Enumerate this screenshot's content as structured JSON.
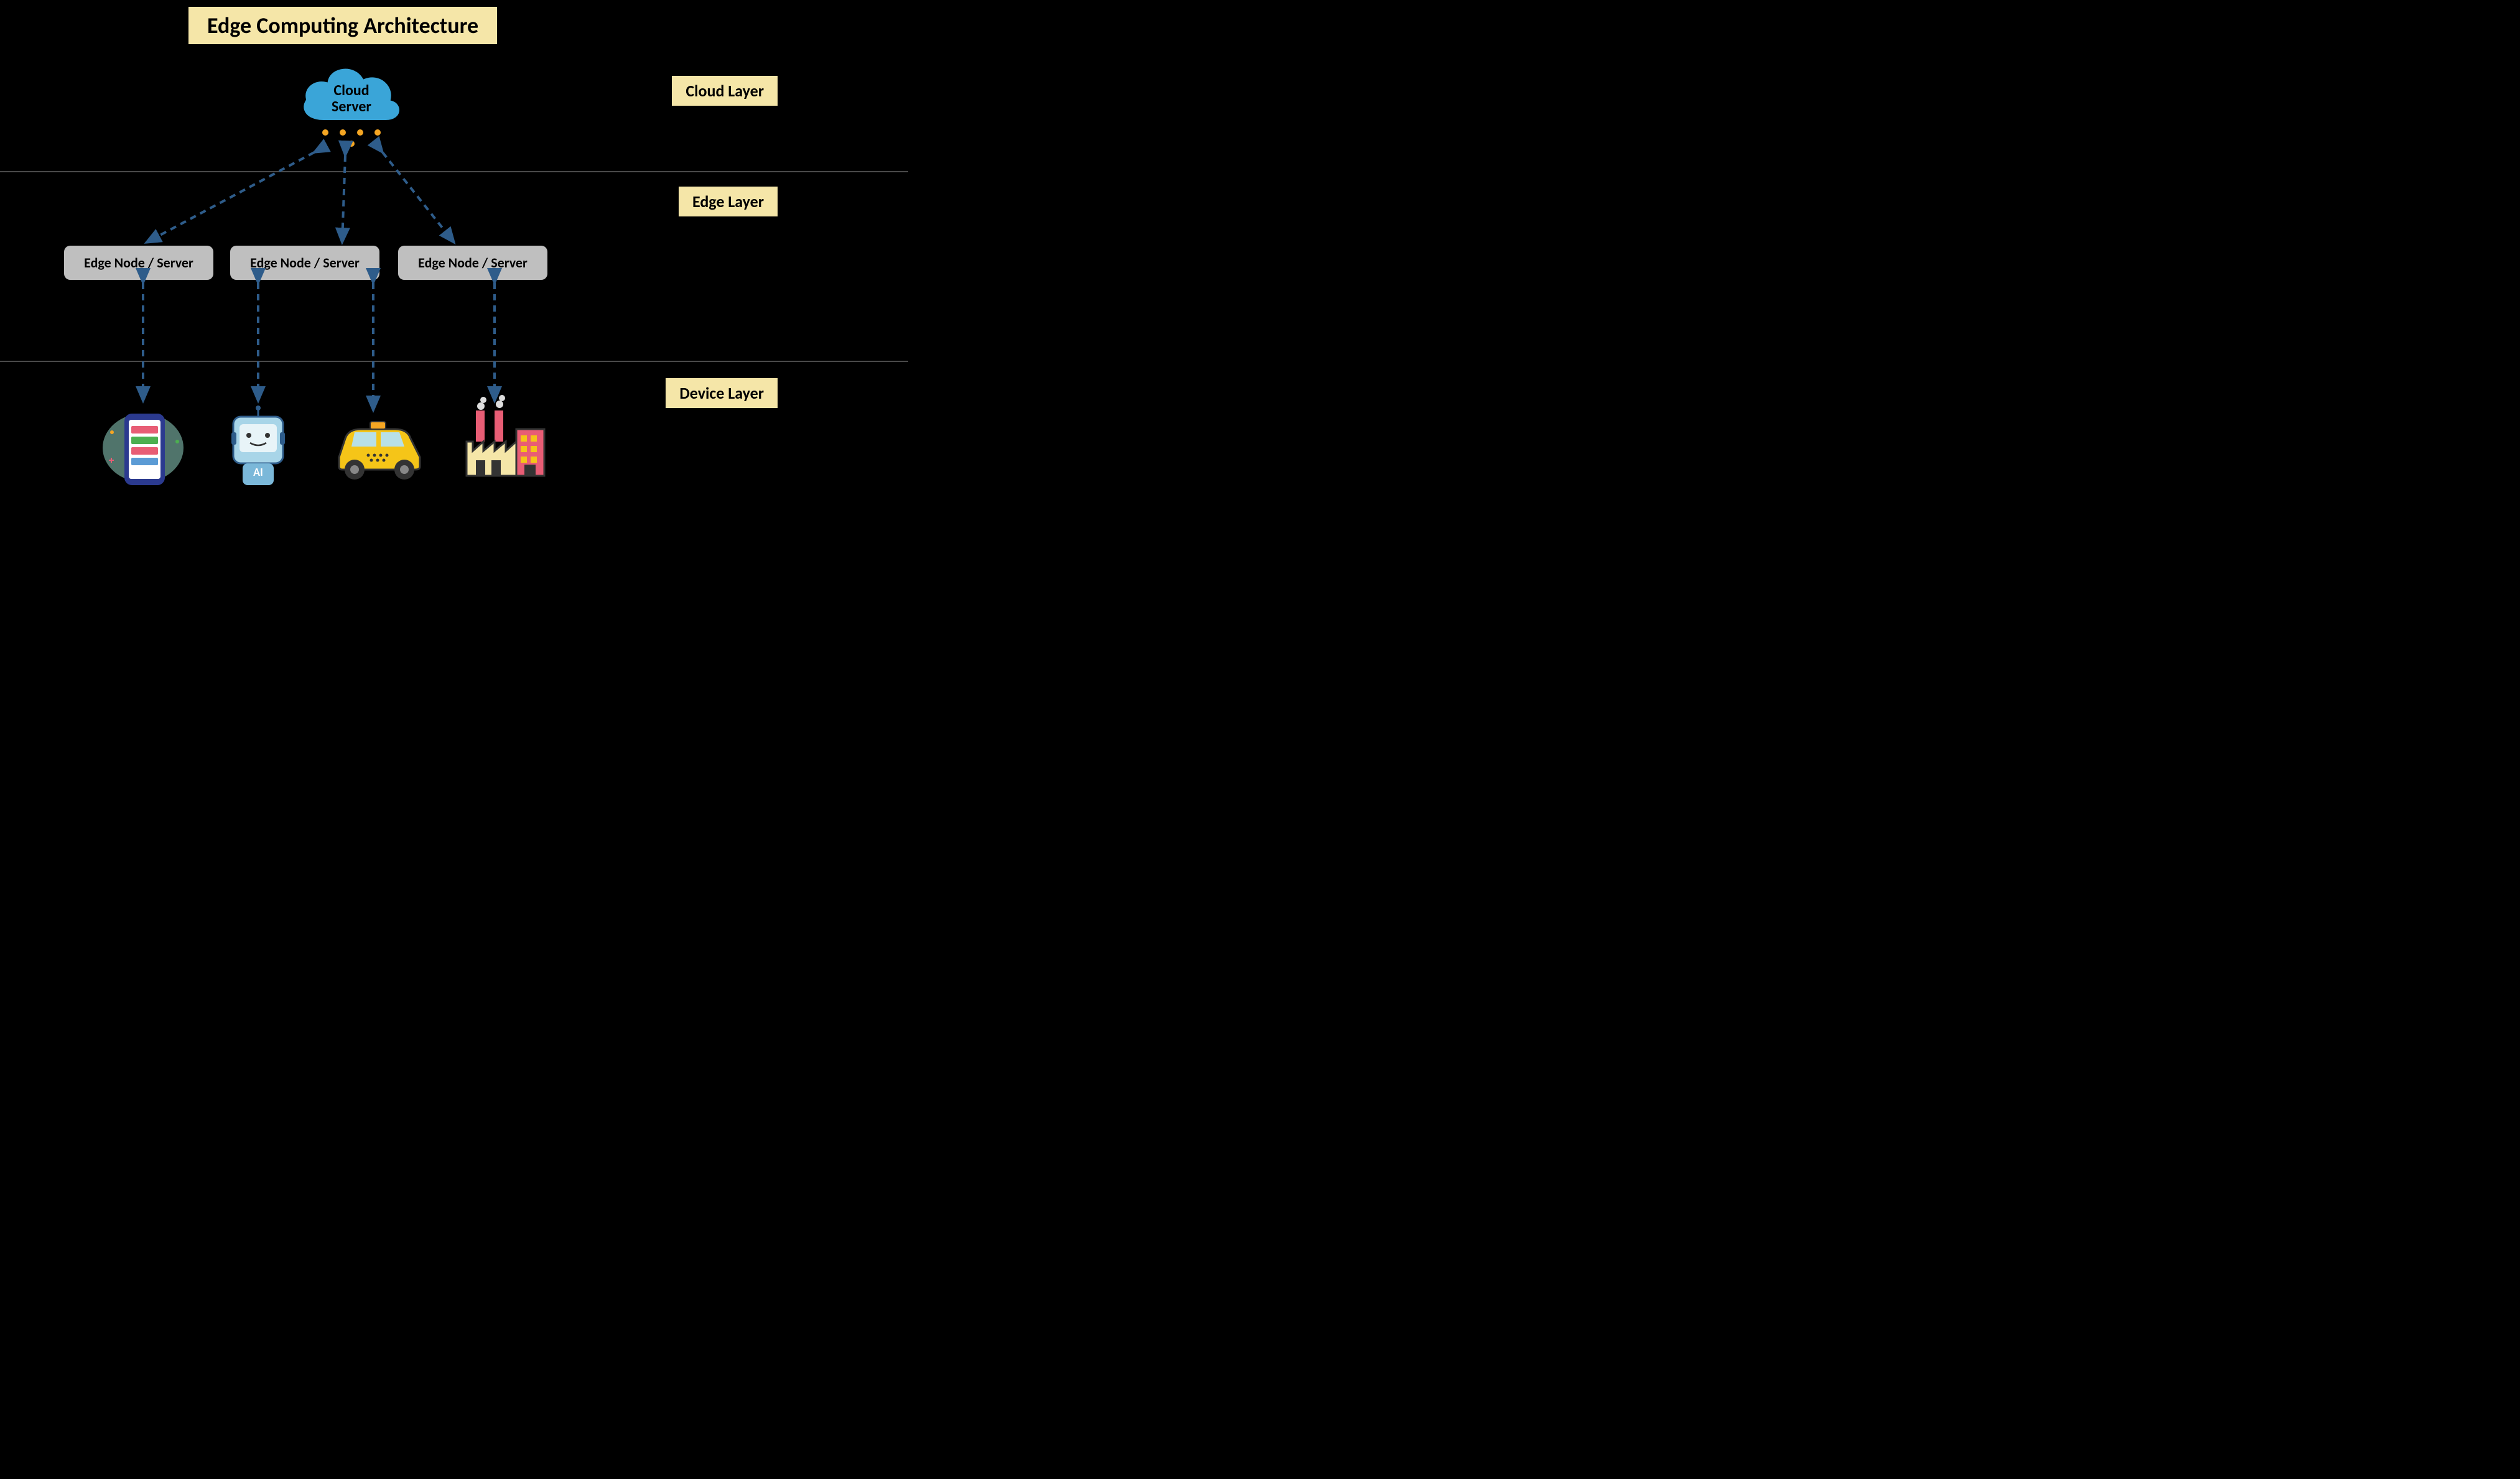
{
  "title": "Edge Computing Architecture",
  "layers": {
    "cloud": "Cloud Layer",
    "edge": "Edge Layer",
    "device": "Device Layer"
  },
  "cloud_server": {
    "line1": "Cloud",
    "line2": "Server"
  },
  "edge_nodes": [
    "Edge Node / Server",
    "Edge Node / Server",
    "Edge Node / Server"
  ],
  "devices": [
    "smartphone",
    "ai-robot",
    "car",
    "factory"
  ]
}
